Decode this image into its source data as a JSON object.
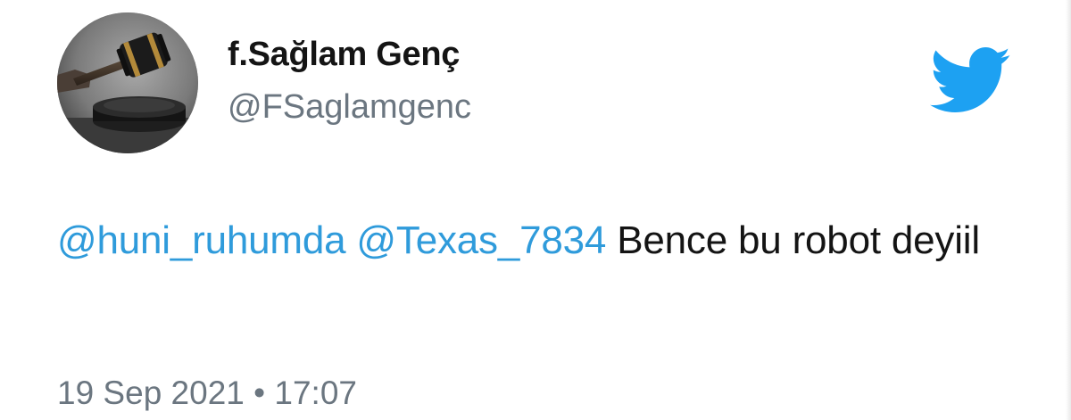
{
  "author": {
    "display_name": "f.Sağlam Genç",
    "handle": "@FSaglamgenc",
    "avatar_icon": "judge-gavel-avatar"
  },
  "brand": {
    "icon": "twitter-bird-icon",
    "color": "#1DA1F2"
  },
  "tweet": {
    "mentions": [
      "@huni_ruhumda",
      "@Texas_7834"
    ],
    "text": "Bence bu robot deyiil",
    "mention_color": "#2F9BDB"
  },
  "meta": {
    "date": "19 Sep 2021",
    "separator": "•",
    "time": "17:07"
  }
}
